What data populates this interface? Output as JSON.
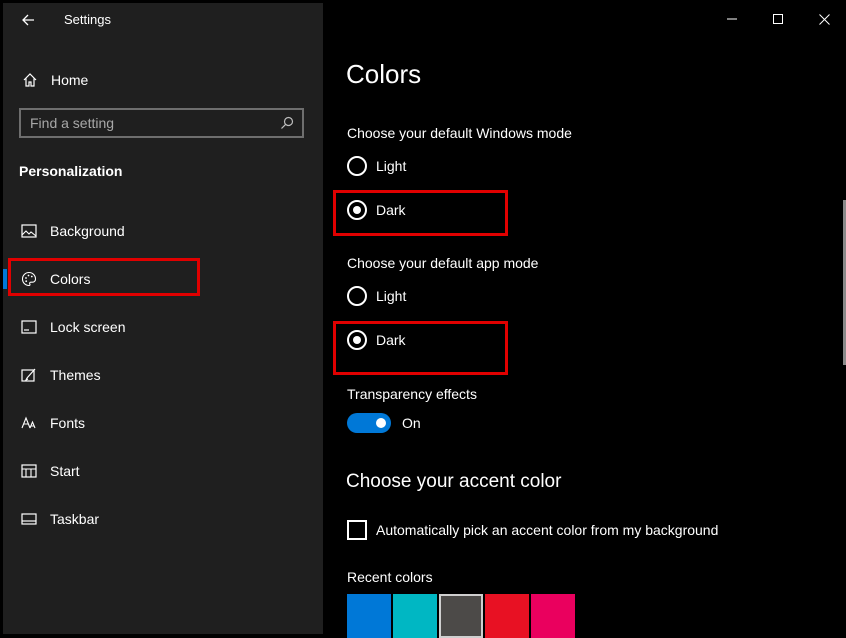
{
  "window": {
    "title": "Settings",
    "captions": {
      "minimize": "minimize",
      "maximize": "maximize",
      "close": "close"
    }
  },
  "sidebar": {
    "home_label": "Home",
    "search_placeholder": "Find a setting",
    "section_label": "Personalization",
    "items": [
      {
        "label": "Background",
        "icon": "picture-icon"
      },
      {
        "label": "Colors",
        "icon": "palette-icon",
        "selected": true
      },
      {
        "label": "Lock screen",
        "icon": "lock-screen-icon"
      },
      {
        "label": "Themes",
        "icon": "themes-icon"
      },
      {
        "label": "Fonts",
        "icon": "fonts-icon"
      },
      {
        "label": "Start",
        "icon": "start-icon"
      },
      {
        "label": "Taskbar",
        "icon": "taskbar-icon"
      }
    ]
  },
  "main": {
    "title": "Colors",
    "windows_mode": {
      "label": "Choose your default Windows mode",
      "options": [
        "Light",
        "Dark"
      ],
      "selected": "Dark"
    },
    "app_mode": {
      "label": "Choose your default app mode",
      "options": [
        "Light",
        "Dark"
      ],
      "selected": "Dark"
    },
    "transparency": {
      "label": "Transparency effects",
      "state": "On"
    },
    "accent_heading": "Choose your accent color",
    "auto_accent_label": "Automatically pick an accent color from my background",
    "recent_colors_label": "Recent colors",
    "recent_colors": [
      "#0078d7",
      "#00b7c3",
      "#4c4a48",
      "#e81123",
      "#ea005e"
    ],
    "selected_recent_color": "#4c4a48"
  },
  "colors": {
    "accent": "#0078d7",
    "highlight_box": "#e00000",
    "sidebar_bg": "#1f1f1f",
    "main_bg": "#000000"
  }
}
